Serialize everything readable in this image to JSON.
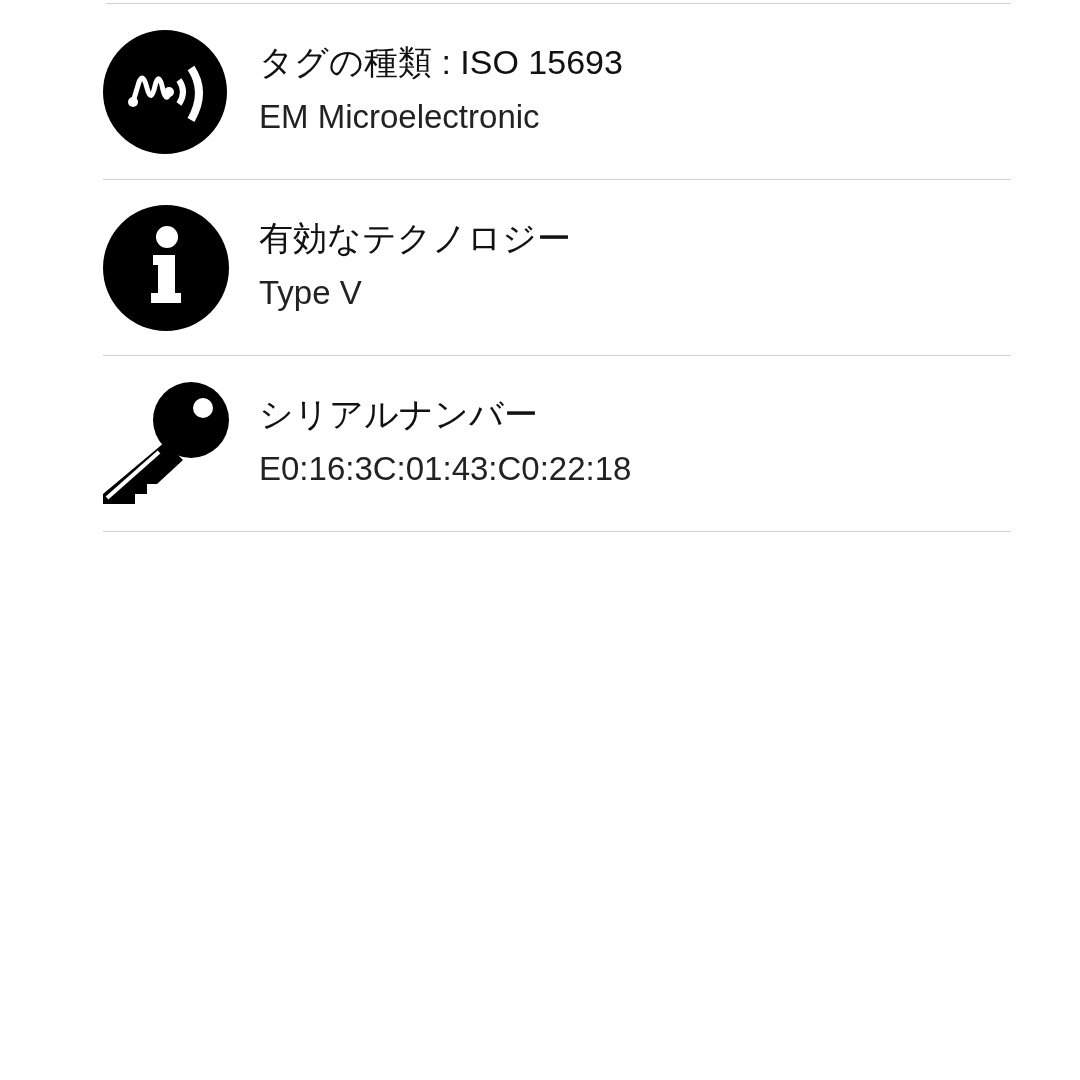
{
  "rows": [
    {
      "kind": "nfc",
      "title": "タグの種類 : ISO 15693",
      "subtitle": "EM Microelectronic"
    },
    {
      "kind": "info",
      "title": "有効なテクノロジー",
      "subtitle": "Type V"
    },
    {
      "kind": "key",
      "title": "シリアルナンバー",
      "subtitle": "E0:16:3C:01:43:C0:22:18"
    }
  ]
}
